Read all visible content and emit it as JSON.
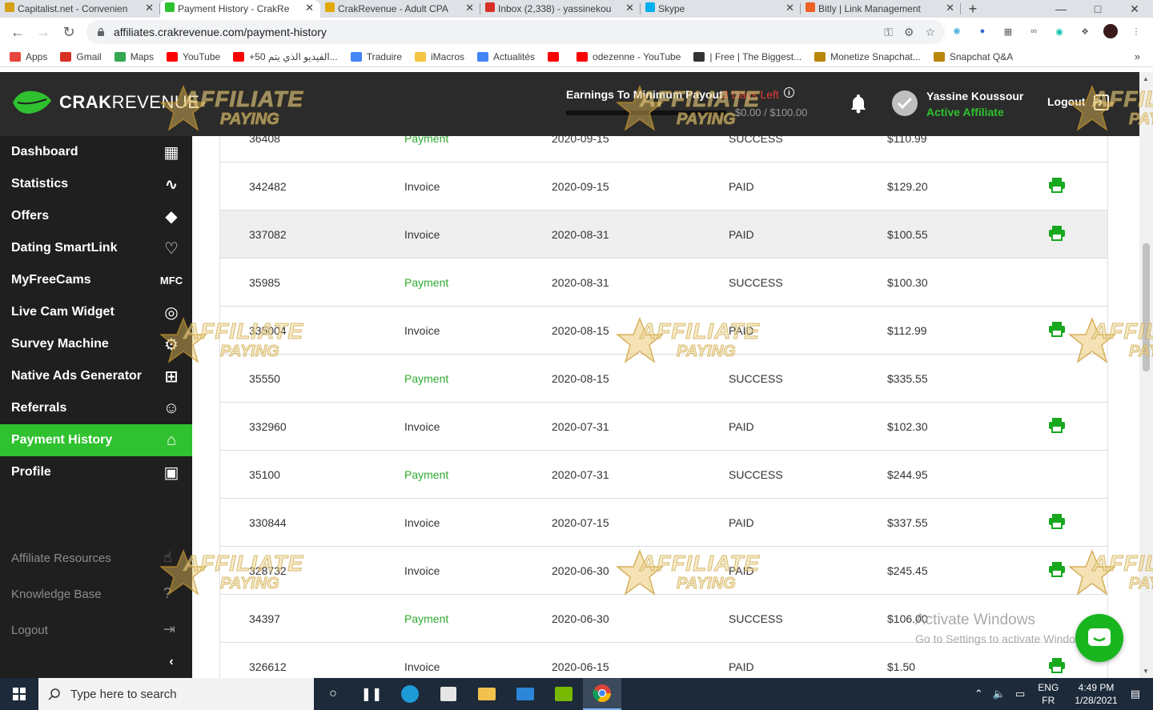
{
  "browser": {
    "tabs": [
      {
        "title": "Capitalist.net - Convenien",
        "icon": "capitalist-favicon",
        "color": "#d4a017"
      },
      {
        "title": "Payment History - CrakRe",
        "icon": "crakrevenue-favicon",
        "color": "#2fc12f"
      },
      {
        "title": "CrakRevenue - Adult CPA",
        "icon": "affiliate-star-favicon",
        "color": "#e0a800"
      },
      {
        "title": "Inbox (2,338) - yassinekou",
        "icon": "gmail-favicon",
        "color": "#d93025"
      },
      {
        "title": "Skype",
        "icon": "skype-favicon",
        "color": "#00aff0"
      },
      {
        "title": "Bitly | Link Management",
        "icon": "bitly-favicon",
        "color": "#ee6123"
      }
    ],
    "url": "affiliates.crakrevenue.com/payment-history",
    "bookmarks": [
      {
        "label": "Apps",
        "icon": "apps-grid-icon",
        "color": "#e8453c"
      },
      {
        "label": "Gmail",
        "icon": "gmail-icon",
        "color": "#d93025"
      },
      {
        "label": "Maps",
        "icon": "maps-pin-icon",
        "color": "#34a853"
      },
      {
        "label": "YouTube",
        "icon": "youtube-icon",
        "color": "#ff0000"
      },
      {
        "label": "+50 الفيديو الذي يتم...",
        "icon": "youtube-icon",
        "color": "#ff0000"
      },
      {
        "label": "Traduire",
        "icon": "translate-icon",
        "color": "#4285f4"
      },
      {
        "label": "iMacros",
        "icon": "folder-icon",
        "color": "#f4c542"
      },
      {
        "label": "Actualités",
        "icon": "news-icon",
        "color": "#4285f4"
      },
      {
        "label": "",
        "icon": "youtube-icon",
        "color": "#ff0000"
      },
      {
        "label": "odezenne - YouTube",
        "icon": "youtube-icon",
        "color": "#ff0000"
      },
      {
        "label": "| Free | The Biggest...",
        "icon": "printer-icon",
        "color": "#333333"
      },
      {
        "label": "Monetize Snapchat...",
        "icon": "money-bag-icon",
        "color": "#b8860b"
      },
      {
        "label": "Snapchat Q&A",
        "icon": "money-bag-icon",
        "color": "#b8860b"
      }
    ],
    "bookmarks_more": "»"
  },
  "header": {
    "logo_bold": "CRAK",
    "logo_thin": "REVENUE",
    "earnings_label": "Earnings To Minimum Payout",
    "days_left": "3 Days Left",
    "payout_amount": "$0.00 / $100.00",
    "payout_progress": 0,
    "user_name": "Yassine Koussour",
    "user_status": "Active Affiliate",
    "logout_label": "Logout",
    "accent_color": "#2fc12f"
  },
  "sidebar": {
    "items": [
      {
        "label": "Dashboard",
        "icon": "dashboard-icon",
        "active": false
      },
      {
        "label": "Statistics",
        "icon": "trend-line-icon",
        "active": false
      },
      {
        "label": "Offers",
        "icon": "tag-icon",
        "active": false
      },
      {
        "label": "Dating SmartLink",
        "icon": "heart-link-icon",
        "active": false
      },
      {
        "label": "MyFreeCams",
        "icon": "mfc-icon",
        "icon_text": "MFC",
        "active": false
      },
      {
        "label": "Live Cam Widget",
        "icon": "webcam-icon",
        "active": false
      },
      {
        "label": "Survey Machine",
        "icon": "survey-gear-icon",
        "active": false
      },
      {
        "label": "Native Ads Generator",
        "icon": "grid-ads-icon",
        "active": false
      },
      {
        "label": "Referrals",
        "icon": "add-user-icon",
        "active": false
      },
      {
        "label": "Payment History",
        "icon": "bank-icon",
        "active": true
      },
      {
        "label": "Profile",
        "icon": "profile-card-icon",
        "active": false
      }
    ],
    "sub_items": [
      {
        "label": "Affiliate Resources",
        "icon": "thumbs-up-icon"
      },
      {
        "label": "Knowledge Base",
        "icon": "help-icon"
      },
      {
        "label": "Logout",
        "icon": "logout-icon"
      }
    ],
    "collapse_label": "‹"
  },
  "payments": {
    "rows": [
      {
        "id": "36408",
        "type": "Payment",
        "date": "2020-09-15",
        "status": "SUCCESS",
        "amount": "$110.99",
        "printable": false
      },
      {
        "id": "342482",
        "type": "Invoice",
        "date": "2020-09-15",
        "status": "PAID",
        "amount": "$129.20",
        "printable": true
      },
      {
        "id": "337082",
        "type": "Invoice",
        "date": "2020-08-31",
        "status": "PAID",
        "amount": "$100.55",
        "printable": true
      },
      {
        "id": "35985",
        "type": "Payment",
        "date": "2020-08-31",
        "status": "SUCCESS",
        "amount": "$100.30",
        "printable": false
      },
      {
        "id": "335004",
        "type": "Invoice",
        "date": "2020-08-15",
        "status": "PAID",
        "amount": "$112.99",
        "printable": true
      },
      {
        "id": "35550",
        "type": "Payment",
        "date": "2020-08-15",
        "status": "SUCCESS",
        "amount": "$335.55",
        "printable": false
      },
      {
        "id": "332960",
        "type": "Invoice",
        "date": "2020-07-31",
        "status": "PAID",
        "amount": "$102.30",
        "printable": true
      },
      {
        "id": "35100",
        "type": "Payment",
        "date": "2020-07-31",
        "status": "SUCCESS",
        "amount": "$244.95",
        "printable": false
      },
      {
        "id": "330844",
        "type": "Invoice",
        "date": "2020-07-15",
        "status": "PAID",
        "amount": "$337.55",
        "printable": true
      },
      {
        "id": "328732",
        "type": "Invoice",
        "date": "2020-06-30",
        "status": "PAID",
        "amount": "$245.45",
        "printable": true
      },
      {
        "id": "34397",
        "type": "Payment",
        "date": "2020-06-30",
        "status": "SUCCESS",
        "amount": "$106.00",
        "printable": false
      },
      {
        "id": "326612",
        "type": "Invoice",
        "date": "2020-06-15",
        "status": "PAID",
        "amount": "$1.50",
        "printable": true
      }
    ],
    "payment_color": "#2fa82f",
    "print_color": "#18a81f"
  },
  "watermark": {
    "line1": "AFFILIATE",
    "line2": "PAYING"
  },
  "activate_windows": {
    "title": "Activate Windows",
    "subtitle": "Go to Settings to activate Windows."
  },
  "taskbar": {
    "search_placeholder": "Type here to search",
    "lang_top": "ENG",
    "lang_bottom": "FR",
    "time": "4:49 PM",
    "date": "1/28/2021"
  }
}
